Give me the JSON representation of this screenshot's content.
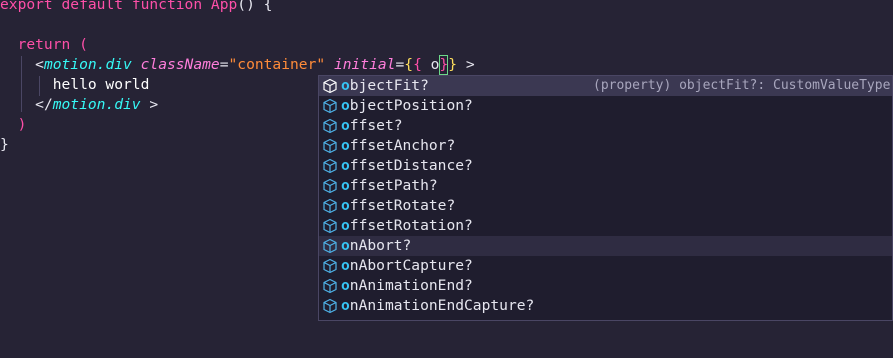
{
  "code": {
    "line1": {
      "kw1": "export",
      "kw2": "default",
      "kw3": "function",
      "fn": "App",
      "rest": "() {"
    },
    "line3": {
      "kw": "return",
      "paren": "("
    },
    "line4": {
      "open": "<",
      "tag": "motion.div",
      "attr1": "className",
      "eq": "=",
      "str": "\"container\"",
      "attr2": "initial",
      "eq2": "=",
      "b1": "{",
      "b2": "{",
      "typed": " o",
      "b3": "}",
      "b4": "}",
      "close": " >"
    },
    "line5": {
      "text": "hello world"
    },
    "line6": {
      "open": "</",
      "tag": "motion.div",
      "close": " >"
    },
    "line7": {
      "paren": ")"
    },
    "line8": {
      "brace": "}"
    }
  },
  "suggest": {
    "match_prefix": "o",
    "items": [
      {
        "label": "objectFit?",
        "rest": "bjectFit?",
        "detail": "(property) objectFit?: CustomValueType"
      },
      {
        "label": "objectPosition?",
        "rest": "bjectPosition?"
      },
      {
        "label": "offset?",
        "rest": "ffset?"
      },
      {
        "label": "offsetAnchor?",
        "rest": "ffsetAnchor?"
      },
      {
        "label": "offsetDistance?",
        "rest": "ffsetDistance?"
      },
      {
        "label": "offsetPath?",
        "rest": "ffsetPath?"
      },
      {
        "label": "offsetRotate?",
        "rest": "ffsetRotate?"
      },
      {
        "label": "offsetRotation?",
        "rest": "ffsetRotation?"
      },
      {
        "label": "onAbort?",
        "rest": "nAbort?"
      },
      {
        "label": "onAbortCapture?",
        "rest": "nAbortCapture?"
      },
      {
        "label": "onAnimationEnd?",
        "rest": "nAnimationEnd?"
      },
      {
        "label": "onAnimationEndCapture?",
        "rest": "nAnimationEndCapture?"
      }
    ]
  },
  "colors": {
    "background": "#262335",
    "keyword": "#fe4fa8",
    "tag": "#36f9f6",
    "attribute": "#ff7edb",
    "string": "#ff8b39",
    "brace": "#fede5d",
    "match": "#36c5f4",
    "icon": "#4fb3e8"
  },
  "icons": {
    "suggestion": "cube-icon"
  }
}
